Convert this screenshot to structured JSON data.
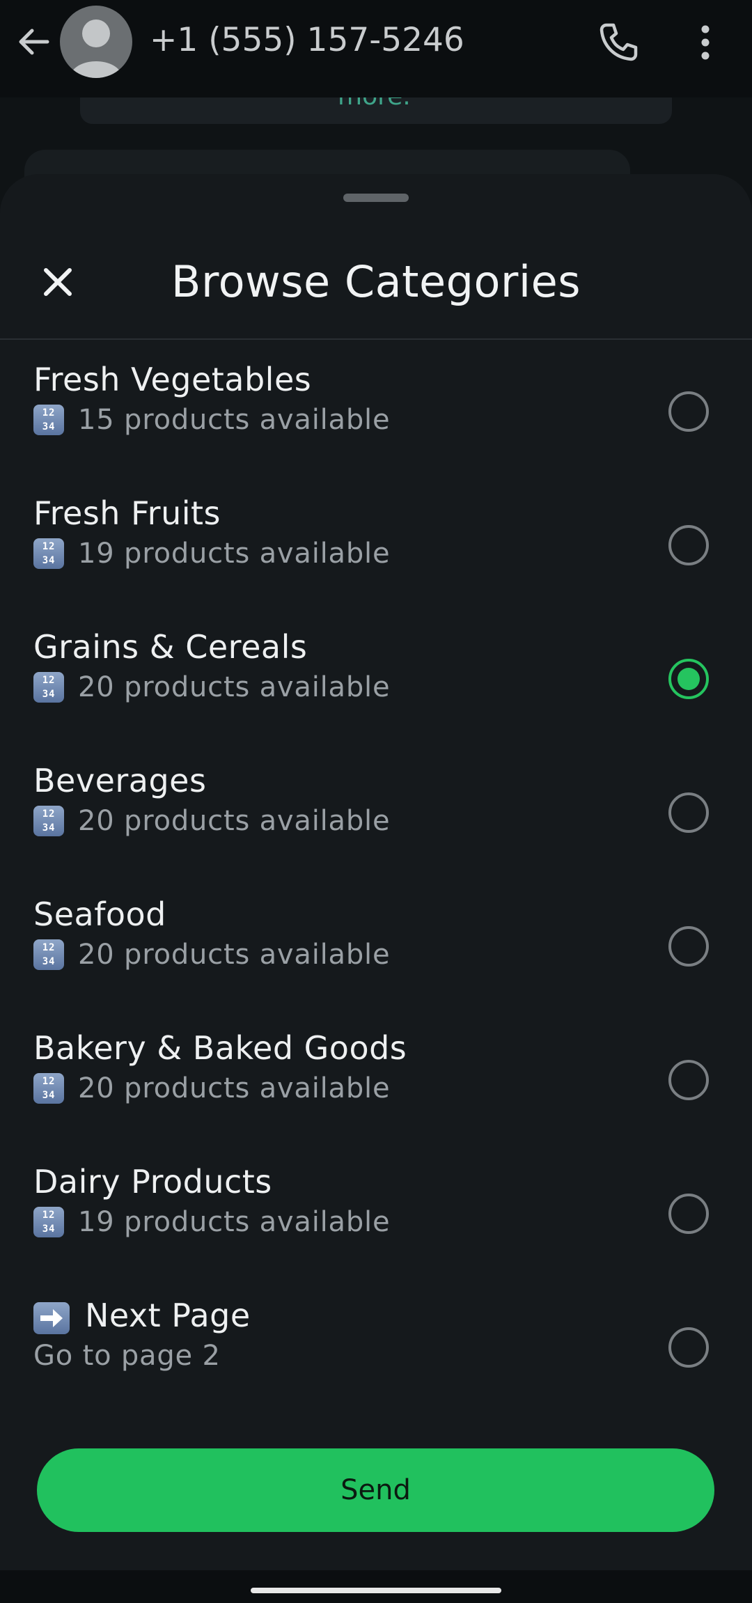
{
  "header": {
    "contact": "+1 (555) 157-5246",
    "icons": {
      "back": "arrow-left-icon",
      "avatar": "default-avatar-icon",
      "call": "phone-icon",
      "more": "more-vertical-icon"
    }
  },
  "background": {
    "bubble_text": "more."
  },
  "sheet": {
    "title": "Browse Categories",
    "close_icon": "close-icon",
    "items": [
      {
        "title": "Fresh Vegetables",
        "subtitle": "15 products available",
        "selected": false
      },
      {
        "title": "Fresh Fruits",
        "subtitle": "19 products available",
        "selected": false
      },
      {
        "title": "Grains & Cereals",
        "subtitle": "20 products available",
        "selected": true
      },
      {
        "title": "Beverages",
        "subtitle": "20 products available",
        "selected": false
      },
      {
        "title": "Seafood",
        "subtitle": "20 products available",
        "selected": false
      },
      {
        "title": "Bakery & Baked Goods",
        "subtitle": "20 products available",
        "selected": false
      },
      {
        "title": "Dairy Products",
        "subtitle": "19 products available",
        "selected": false
      },
      {
        "title": "Next Page",
        "subtitle": "Go to page 2",
        "selected": false
      }
    ],
    "send_label": "Send"
  },
  "colors": {
    "accent": "#21c15e",
    "sheet_bg": "#15191c",
    "app_bg": "#0b0e10"
  }
}
